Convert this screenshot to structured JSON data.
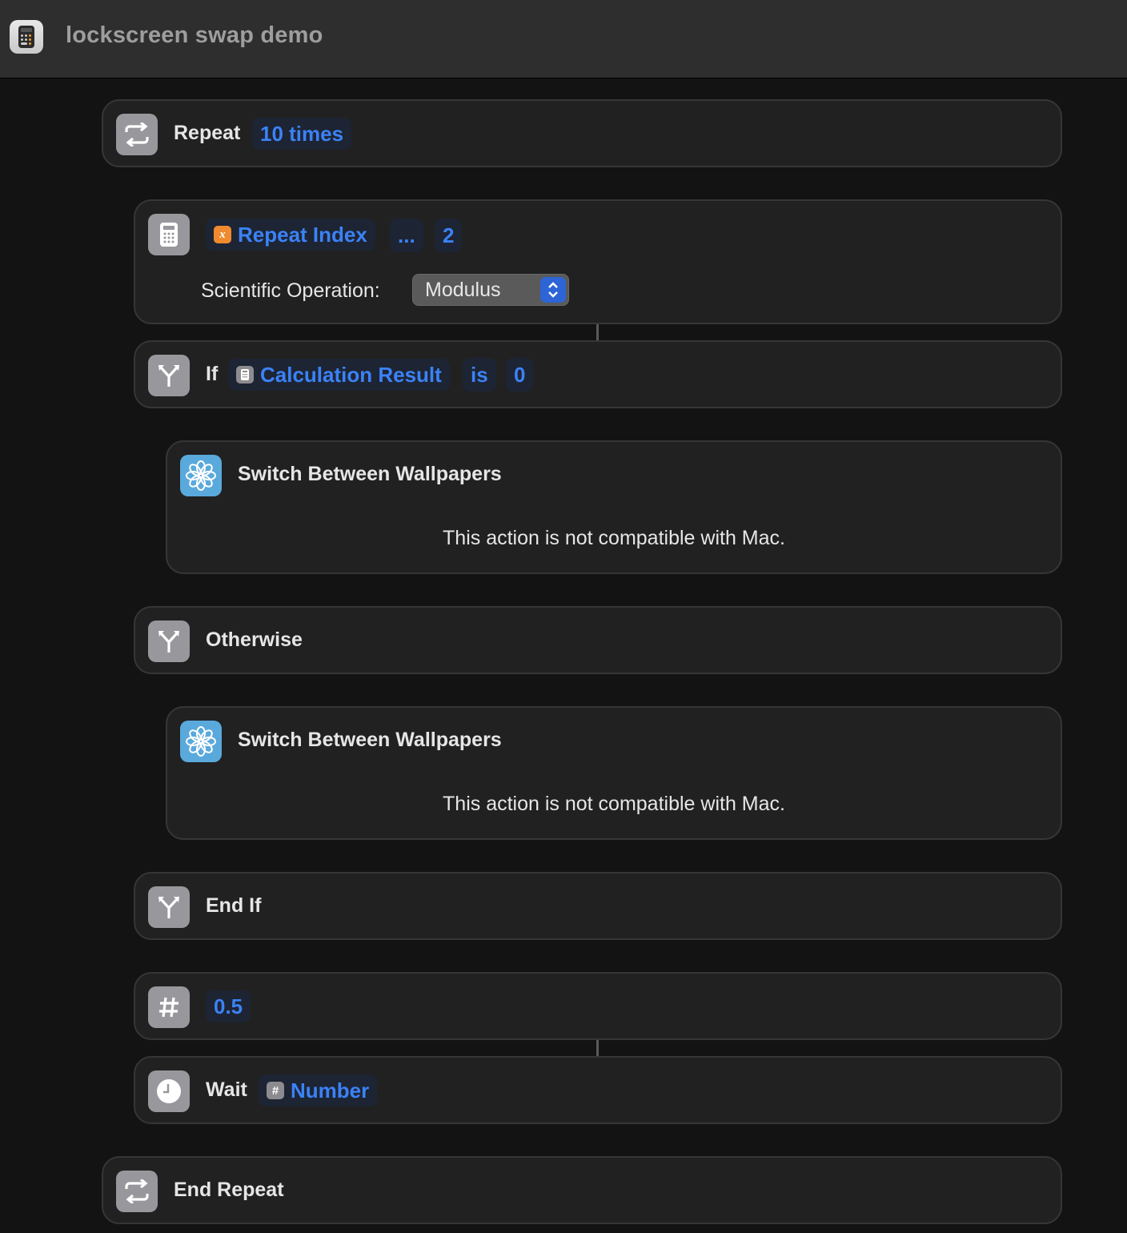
{
  "window": {
    "title": "lockscreen swap demo",
    "app_icon": "calculator-icon"
  },
  "actions": {
    "repeat": {
      "label": "Repeat",
      "count_token": "10 times",
      "icon": "repeat-icon"
    },
    "calculate": {
      "icon": "calculator-icon",
      "operand_variable": {
        "icon": "variable-x-icon",
        "label": "Repeat Index"
      },
      "operator": "...",
      "operand_value": "2",
      "option_label": "Scientific Operation:",
      "option_value": "Modulus"
    },
    "if": {
      "label": "If",
      "icon": "branch-icon",
      "variable": {
        "icon": "calculator-icon",
        "label": "Calculation Result"
      },
      "condition": "is",
      "value": "0"
    },
    "switch_wallpaper_1": {
      "label": "Switch Between Wallpapers",
      "icon": "flower-icon",
      "message": "This action is not compatible with Mac."
    },
    "otherwise": {
      "label": "Otherwise",
      "icon": "branch-icon"
    },
    "switch_wallpaper_2": {
      "label": "Switch Between Wallpapers",
      "icon": "flower-icon",
      "message": "This action is not compatible with Mac."
    },
    "end_if": {
      "label": "End If",
      "icon": "branch-icon"
    },
    "number": {
      "value": "0.5",
      "icon": "hash-icon"
    },
    "wait": {
      "label": "Wait",
      "icon": "clock-icon",
      "variable": {
        "icon": "hash-icon",
        "label": "Number"
      }
    },
    "end_repeat": {
      "label": "End Repeat",
      "icon": "repeat-icon"
    }
  },
  "colors": {
    "token_text": "#3b82f6",
    "token_bg": "#1d2433",
    "card_bg": "#212121",
    "icon_tile": "#98979c",
    "wallpaper_icon": "#5aa9dc"
  }
}
